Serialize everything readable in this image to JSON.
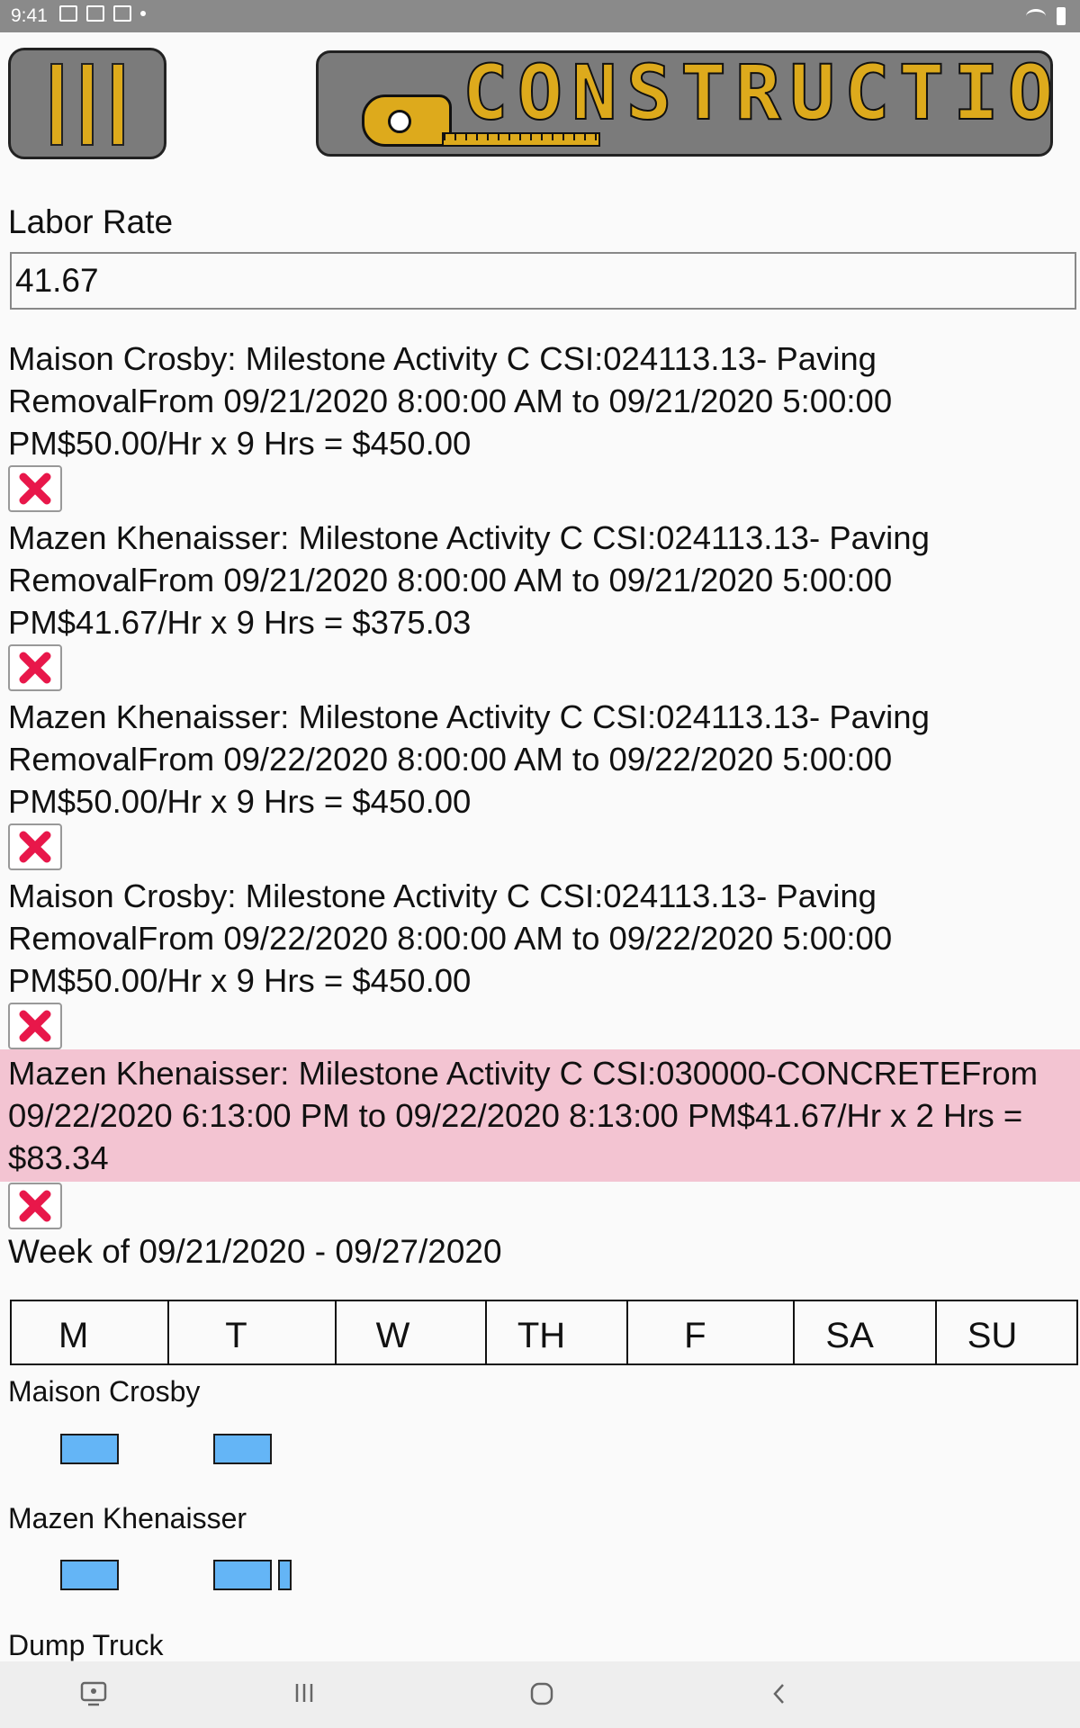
{
  "status_bar": {
    "time": "9:41"
  },
  "header": {
    "menu_icon": "hamburger-vertical-bars-icon",
    "logo_text": "CONSTRUCTION",
    "logo_icon": "tape-measure-icon",
    "accent_color": "#ddaa1c"
  },
  "labor_rate": {
    "label": "Labor Rate",
    "value": "41.67"
  },
  "entries": [
    {
      "text": "Maison Crosby:  Milestone Activity C CSI:024113.13- Paving RemovalFrom 09/21/2020 8:00:00 AM to 09/21/2020 5:00:00 PM$50.00/Hr x 9 Hrs = $450.00",
      "highlight": false
    },
    {
      "text": "Mazen Khenaisser:  Milestone Activity C CSI:024113.13- Paving RemovalFrom 09/21/2020 8:00:00 AM to 09/21/2020 5:00:00 PM$41.67/Hr x 9 Hrs = $375.03",
      "highlight": false
    },
    {
      "text": "Mazen Khenaisser:  Milestone Activity C CSI:024113.13- Paving RemovalFrom 09/22/2020 8:00:00 AM to 09/22/2020 5:00:00 PM$50.00/Hr x 9 Hrs = $450.00",
      "highlight": false
    },
    {
      "text": "Maison Crosby:  Milestone Activity C CSI:024113.13- Paving RemovalFrom 09/22/2020 8:00:00 AM to 09/22/2020 5:00:00 PM$50.00/Hr x 9 Hrs = $450.00",
      "highlight": false
    },
    {
      "text": "Mazen Khenaisser:  Milestone Activity C CSI:030000-CONCRETEFrom 09/22/2020 6:13:00 PM to 09/22/2020 8:13:00 PM$41.67/Hr x 2 Hrs = $83.34",
      "highlight": true
    }
  ],
  "delete_icon": "delete-x-icon",
  "week": {
    "label": "Week of 09/21/2020 - 09/27/2020",
    "days": [
      "M",
      "T",
      "W",
      "TH",
      "F",
      "SA",
      "SU"
    ]
  },
  "schedule": {
    "block_color": "#64b5f6",
    "rows": [
      {
        "name": "Maison Crosby"
      },
      {
        "name": "Mazen Khenaisser"
      },
      {
        "name": "Dump Truck"
      }
    ]
  },
  "nav_bar": {
    "icons": [
      "screenshot-icon",
      "recent-apps-icon",
      "home-icon",
      "back-icon"
    ]
  }
}
